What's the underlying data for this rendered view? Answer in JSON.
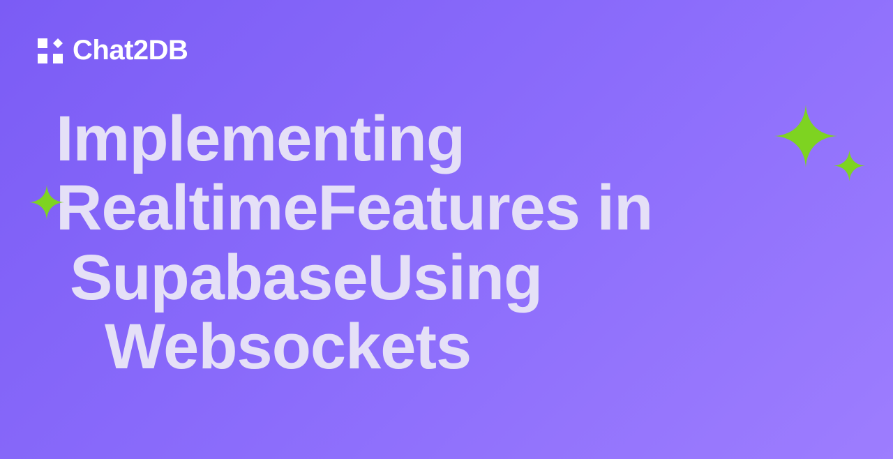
{
  "logo": {
    "text": "Chat2DB"
  },
  "headline": {
    "line1": "Implementing",
    "line2": "RealtimeFeatures in",
    "line3": "SupabaseUsing",
    "line4": "Websockets"
  },
  "colors": {
    "sparkle": "#7ed321"
  }
}
